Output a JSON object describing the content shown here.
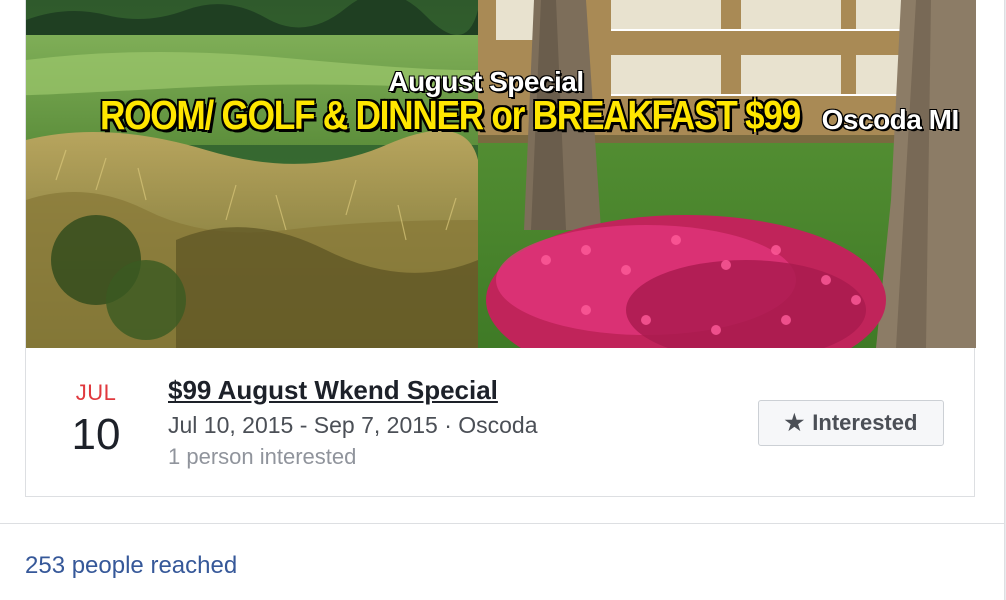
{
  "banner": {
    "special": "August Special",
    "headline": "ROOM/ GOLF & DINNER or BREAKFAST $99",
    "location": "Oscoda MI"
  },
  "event": {
    "month": "JUL",
    "day": "10",
    "title": "$99 August Wkend Special",
    "dates_location": "Jul 10, 2015 - Sep 7, 2015 · Oscoda",
    "interest_count": "1 person interested",
    "interested_button": "Interested"
  },
  "footer": {
    "reach_text": "253 people reached"
  }
}
